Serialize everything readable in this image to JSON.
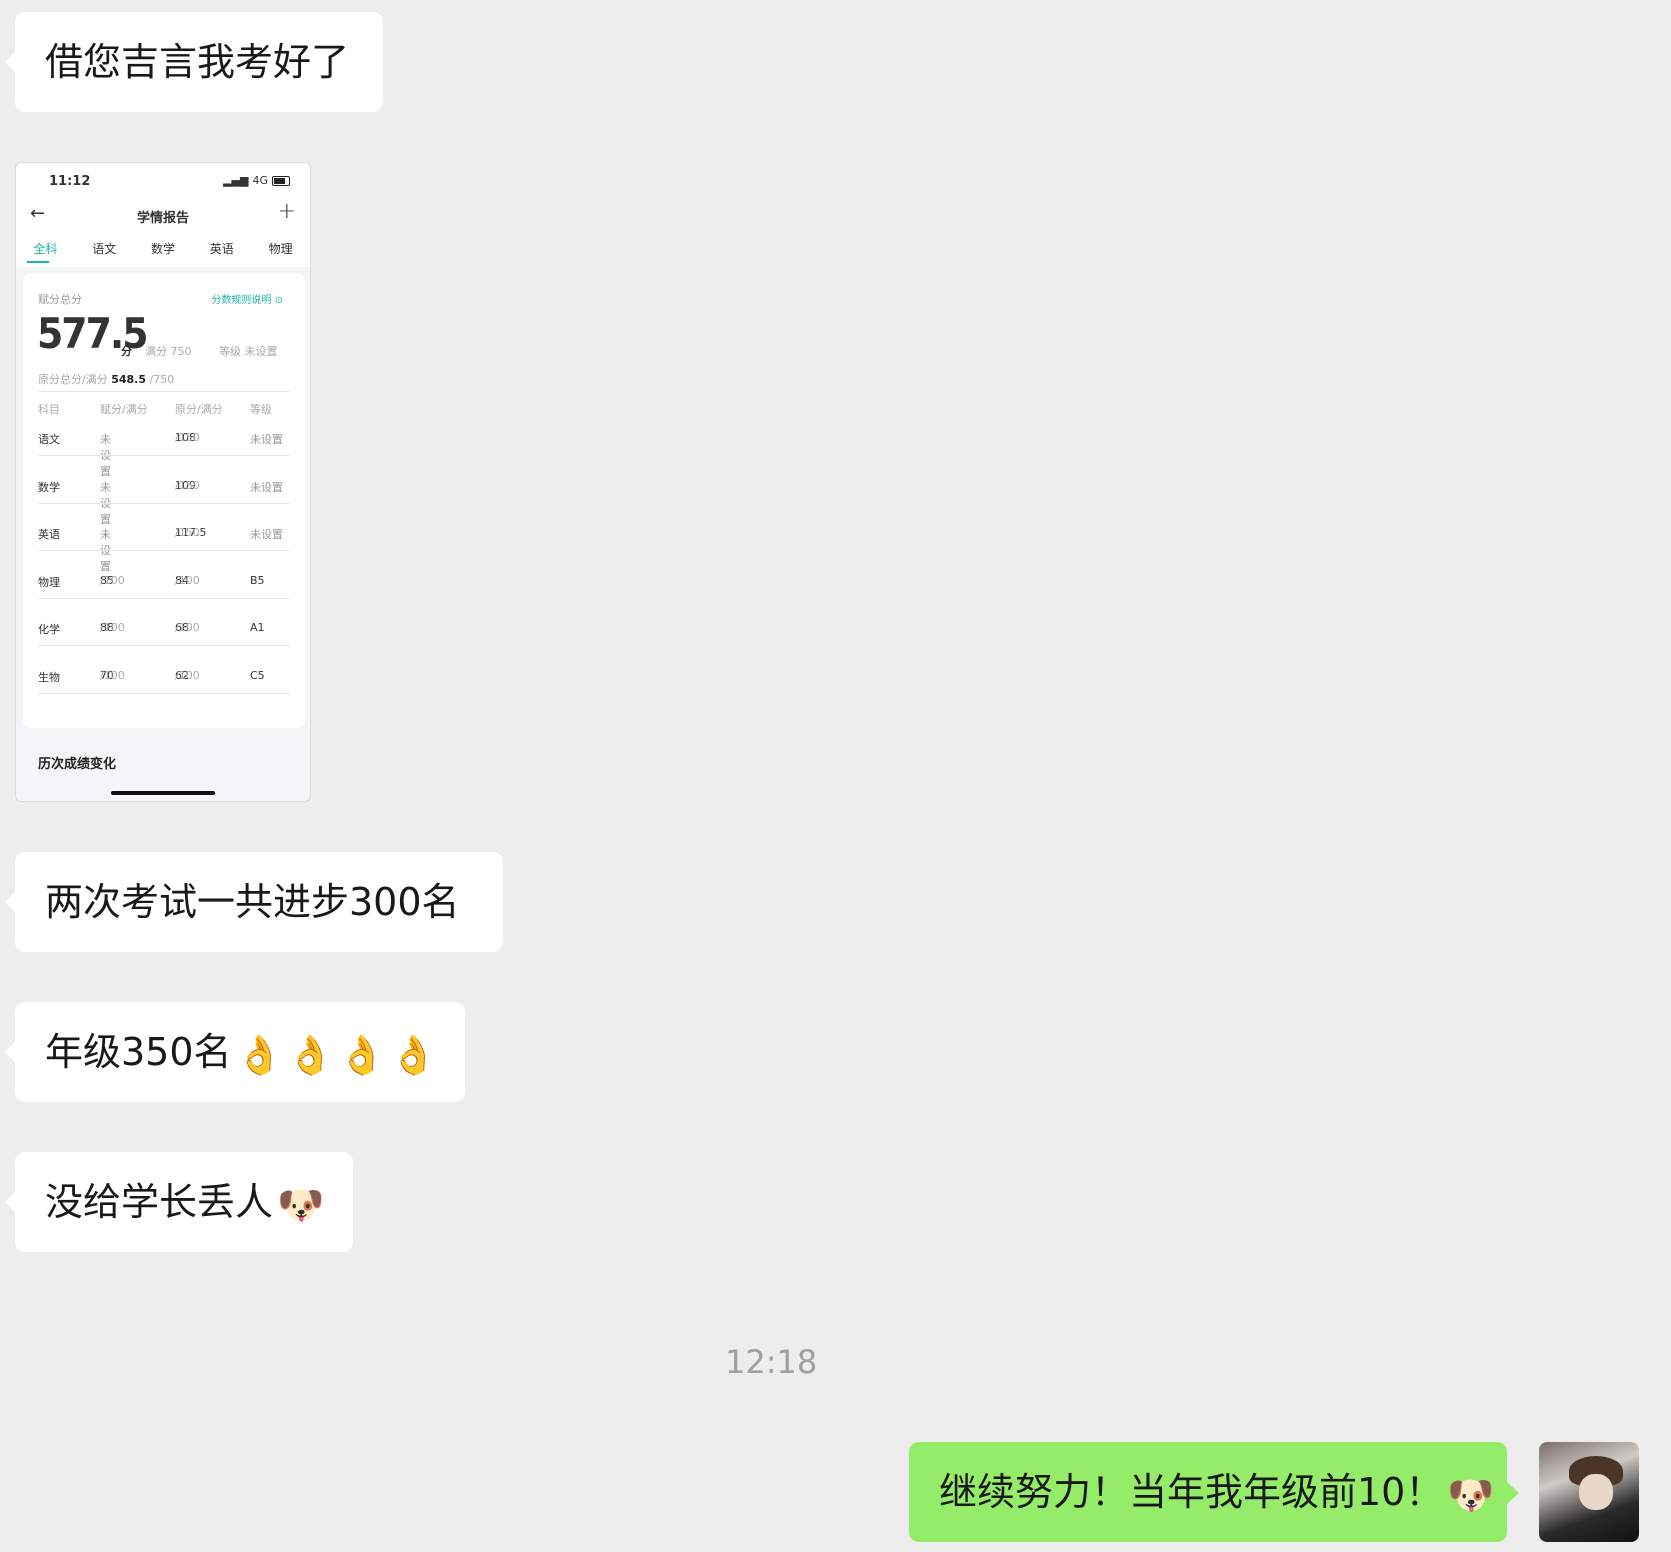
{
  "messages": [
    {
      "side": "left",
      "text": "借您吉言我考好了"
    },
    {
      "side": "left",
      "text": "两次考试一共进步300名"
    },
    {
      "side": "left",
      "text": "年级350名",
      "emoji": [
        "ok-hand-icon",
        "ok-hand-icon",
        "ok-hand-icon",
        "ok-hand-icon"
      ]
    },
    {
      "side": "left",
      "text": "没给学长丢人",
      "emoji": [
        "doge-icon"
      ]
    },
    {
      "side": "right",
      "text": "继续努力！当年我年级前10！",
      "emoji": [
        "doge-icon"
      ]
    }
  ],
  "timestamp": "12:18",
  "report": {
    "status_time": "11:12",
    "network": "4G",
    "title": "学情报告",
    "tabs": [
      "全科",
      "语文",
      "数学",
      "英语",
      "物理"
    ],
    "active_tab": "全科",
    "score_label": "赋分总分",
    "rules_link": "分数规则说明",
    "total_score": "577.5",
    "score_unit": "分",
    "full_score": "满分 750",
    "level": "等级 未设置",
    "raw_label": "原分总分/满分",
    "raw_score": "548.5",
    "raw_full": "/750",
    "columns": [
      "科目",
      "赋分/满分",
      "原分/满分",
      "等级"
    ],
    "rows": [
      {
        "subject": "语文",
        "assigned": "未设置",
        "assigned_full": "",
        "raw": "108",
        "raw_full": "/150",
        "grade": "未设置"
      },
      {
        "subject": "数学",
        "assigned": "未设置",
        "assigned_full": "",
        "raw": "109",
        "raw_full": "/150",
        "grade": "未设置"
      },
      {
        "subject": "英语",
        "assigned": "未设置",
        "assigned_full": "",
        "raw": "117.5",
        "raw_full": "/150",
        "grade": "未设置"
      },
      {
        "subject": "物理",
        "assigned": "85",
        "assigned_full": "/100",
        "raw": "84",
        "raw_full": "/100",
        "grade": "B5"
      },
      {
        "subject": "化学",
        "assigned": "88",
        "assigned_full": "/100",
        "raw": "68",
        "raw_full": "/100",
        "grade": "A1"
      },
      {
        "subject": "生物",
        "assigned": "70",
        "assigned_full": "/100",
        "raw": "62",
        "raw_full": "/100",
        "grade": "C5"
      }
    ],
    "history_title": "历次成绩变化",
    "accent": "#1bb6a5"
  },
  "colors": {
    "background": "#ededed",
    "incoming": "#ffffff",
    "outgoing": "#95ec69"
  }
}
